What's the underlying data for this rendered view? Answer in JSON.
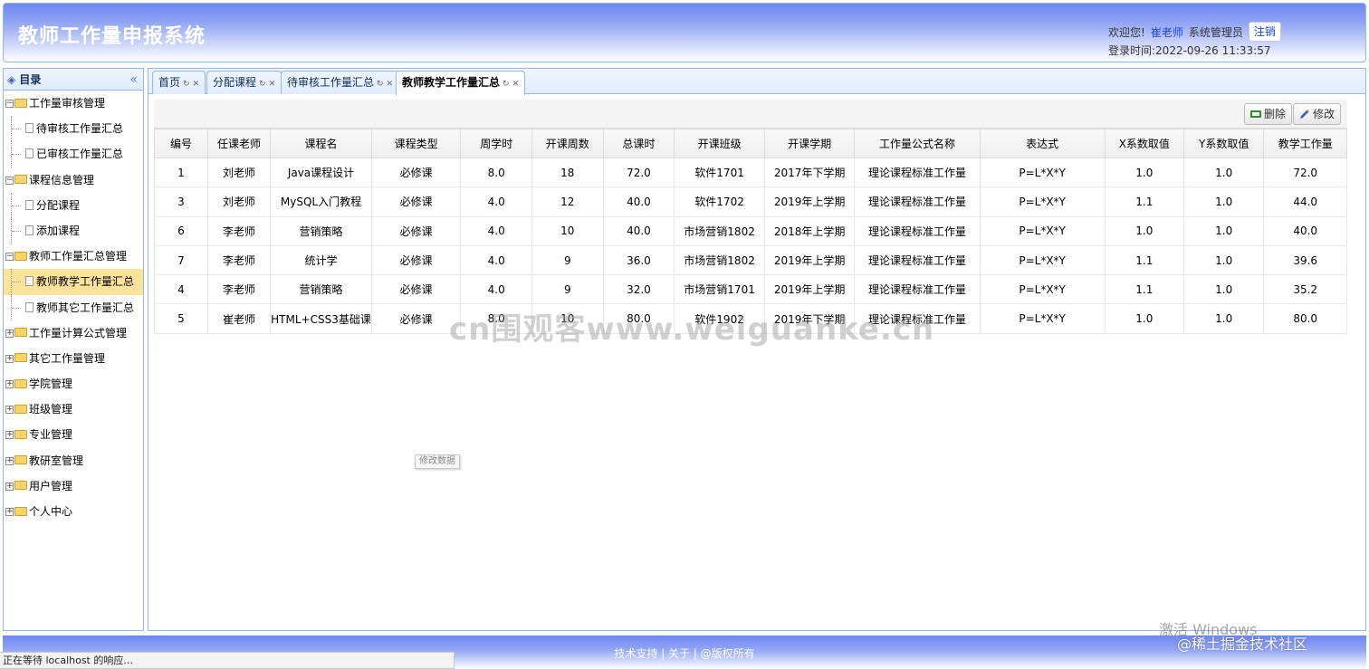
{
  "header": {
    "title": "教师工作量申报系统",
    "welcome": "欢迎您!",
    "user_name": "崔老师",
    "role": "系统管理员",
    "logout": "注销",
    "login_time": "登录时间:2022-09-26 11:33:57"
  },
  "sidebar": {
    "title": "目录",
    "collapse": "«",
    "items": [
      {
        "label": "工作量审核管理",
        "level": 0,
        "expanded": true
      },
      {
        "label": "待审核工作量汇总",
        "level": 1
      },
      {
        "label": "已审核工作量汇总",
        "level": 1
      },
      {
        "label": "课程信息管理",
        "level": 0,
        "expanded": true
      },
      {
        "label": "分配课程",
        "level": 1
      },
      {
        "label": "添加课程",
        "level": 1
      },
      {
        "label": "教师工作量汇总管理",
        "level": 0,
        "expanded": true
      },
      {
        "label": "教师教学工作量汇总",
        "level": 1,
        "selected": true
      },
      {
        "label": "教师其它工作量汇总",
        "level": 1
      },
      {
        "label": "工作量计算公式管理",
        "level": 0
      },
      {
        "label": "其它工作量管理",
        "level": 0
      },
      {
        "label": "学院管理",
        "level": 0
      },
      {
        "label": "班级管理",
        "level": 0
      },
      {
        "label": "专业管理",
        "level": 0
      },
      {
        "label": "教研室管理",
        "level": 0
      },
      {
        "label": "用户管理",
        "level": 0
      },
      {
        "label": "个人中心",
        "level": 0
      }
    ]
  },
  "tabs": [
    {
      "label": "首页",
      "active": false
    },
    {
      "label": "分配课程",
      "active": false
    },
    {
      "label": "待审核工作量汇总",
      "active": false
    },
    {
      "label": "教师教学工作量汇总",
      "active": true
    }
  ],
  "toolbar": {
    "delete_label": "删除",
    "edit_label": "修改"
  },
  "table": {
    "columns": [
      "编号",
      "任课老师",
      "课程名",
      "课程类型",
      "周学时",
      "开课周数",
      "总课时",
      "开课班级",
      "开课学期",
      "工作量公式名称",
      "表达式",
      "X系数取值",
      "Y系数取值",
      "教学工作量"
    ],
    "rows": [
      [
        "1",
        "刘老师",
        "Java课程设计",
        "必修课",
        "8.0",
        "18",
        "72.0",
        "软件1701",
        "2017年下学期",
        "理论课程标准工作量",
        "P=L*X*Y",
        "1.0",
        "1.0",
        "72.0"
      ],
      [
        "3",
        "刘老师",
        "MySQL入门教程",
        "必修课",
        "4.0",
        "12",
        "40.0",
        "软件1702",
        "2019年上学期",
        "理论课程标准工作量",
        "P=L*X*Y",
        "1.1",
        "1.0",
        "44.0"
      ],
      [
        "6",
        "李老师",
        "营销策略",
        "必修课",
        "4.0",
        "10",
        "40.0",
        "市场营销1802",
        "2018年上学期",
        "理论课程标准工作量",
        "P=L*X*Y",
        "1.0",
        "1.0",
        "40.0"
      ],
      [
        "7",
        "李老师",
        "统计学",
        "必修课",
        "4.0",
        "9",
        "36.0",
        "市场营销1802",
        "2019年上学期",
        "理论课程标准工作量",
        "P=L*X*Y",
        "1.1",
        "1.0",
        "39.6"
      ],
      [
        "4",
        "李老师",
        "营销策略",
        "必修课",
        "4.0",
        "9",
        "32.0",
        "市场营销1701",
        "2019年上学期",
        "理论课程标准工作量",
        "P=L*X*Y",
        "1.1",
        "1.0",
        "35.2"
      ],
      [
        "5",
        "崔老师",
        "HTML+CSS3基础课",
        "必修课",
        "8.0",
        "10",
        "80.0",
        "软件1902",
        "2019年下学期",
        "理论课程标准工作量",
        "P=L*X*Y",
        "1.0",
        "1.0",
        "80.0"
      ]
    ]
  },
  "tooltip": "修改数据",
  "watermark": "cn围观客www.weiguanke.cn",
  "footer": {
    "links": "技术支持 | 关于 | @版权所有"
  },
  "status_bar": "正在等待 localhost 的响应...",
  "os_overlay": {
    "activate": "激活 Windows",
    "community": "@稀土掘金技术社区"
  }
}
